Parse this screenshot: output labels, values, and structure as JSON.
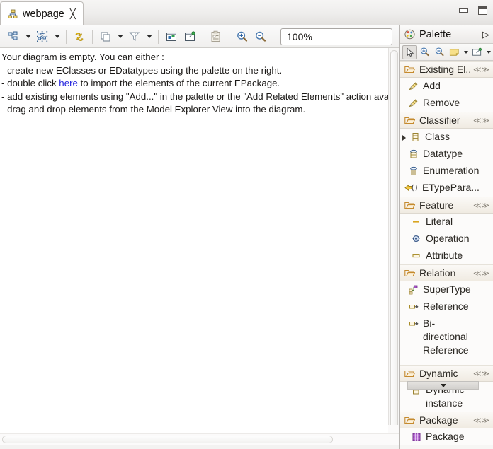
{
  "window": {
    "minimize_label": "Minimize",
    "maximize_label": "Maximize"
  },
  "tab": {
    "title": "webpage",
    "icon": "diagram-icon",
    "close_glyph": "╳"
  },
  "toolbar": {
    "items": [
      {
        "name": "arrange-all-button",
        "icon": "arrange-all-icon",
        "has_dropdown": true
      },
      {
        "name": "select-related-button",
        "icon": "select-nodes-icon",
        "has_dropdown": true
      },
      {
        "name": "refresh-button",
        "icon": "refresh-arrows-icon",
        "has_dropdown": false
      },
      {
        "name": "layers-button",
        "icon": "layers-icon",
        "has_dropdown": true
      },
      {
        "name": "filters-button",
        "icon": "filter-funnel-icon",
        "has_dropdown": true
      },
      {
        "name": "show-hide-button",
        "icon": "window-blue-icon",
        "has_dropdown": false
      },
      {
        "name": "pin-elements-button",
        "icon": "window-pin-icon",
        "has_dropdown": false
      },
      {
        "name": "paste-button",
        "icon": "clipboard-icon",
        "has_dropdown": false
      },
      {
        "name": "zoom-in-button",
        "icon": "zoom-in-icon",
        "has_dropdown": false
      },
      {
        "name": "zoom-out-button",
        "icon": "zoom-out-icon",
        "has_dropdown": false
      }
    ],
    "zoom_value": "100%",
    "zoom_placeholder": "100%"
  },
  "canvas": {
    "lines": [
      "Your diagram is empty. You can either :",
      "- create new EClasses or EDatatypes using the palette on the right.",
      "- double click ",
      "- add existing elements using \"Add...\" in the palette or the \"Add Related Elements\" action available u",
      "- drag and drop elements from the Model Explorer View into the diagram."
    ],
    "link_text": "here",
    "line3_suffix": " to import the elements of the current EPackage."
  },
  "palette": {
    "title": "Palette",
    "icon": "palette-icon",
    "collapse_glyph": "▷",
    "tools": [
      {
        "name": "select-tool",
        "icon": "arrow-cursor-icon",
        "pressed": true,
        "caret": false
      },
      {
        "name": "marquee-zoom-in-tool",
        "icon": "zoom-in-icon",
        "pressed": false,
        "caret": false
      },
      {
        "name": "marquee-zoom-out-tool",
        "icon": "zoom-out-icon",
        "pressed": false,
        "caret": false
      },
      {
        "name": "note-tool",
        "icon": "note-icon",
        "pressed": false,
        "caret": true
      },
      {
        "name": "note-attachment-tool",
        "icon": "note-pin-icon",
        "pressed": false,
        "caret": true
      }
    ],
    "drawers": [
      {
        "name": "existing-elements",
        "label": "Existing El...",
        "pin": "≪≫",
        "items": [
          {
            "name": "palette-item-add",
            "label": "Add",
            "icon": "add-pencil-icon",
            "expandable": false
          },
          {
            "name": "palette-item-remove",
            "label": "Remove",
            "icon": "remove-pencil-icon",
            "expandable": false
          }
        ]
      },
      {
        "name": "classifier",
        "label": "Classifier",
        "pin": "≪≫",
        "items": [
          {
            "name": "palette-item-class",
            "label": "Class",
            "icon": "class-icon",
            "expandable": true
          },
          {
            "name": "palette-item-datatype",
            "label": "Datatype",
            "icon": "datatype-icon",
            "expandable": false
          },
          {
            "name": "palette-item-enumeration",
            "label": "Enumeration",
            "icon": "enumeration-icon",
            "expandable": false
          },
          {
            "name": "palette-item-etypeparameter",
            "label": "ETypePara...",
            "icon": "etypeparameter-icon",
            "expandable": false
          }
        ]
      },
      {
        "name": "feature",
        "label": "Feature",
        "pin": "≪≫",
        "items": [
          {
            "name": "palette-item-literal",
            "label": "Literal",
            "icon": "literal-icon",
            "expandable": false
          },
          {
            "name": "palette-item-operation",
            "label": "Operation",
            "icon": "operation-icon",
            "expandable": false
          },
          {
            "name": "palette-item-attribute",
            "label": "Attribute",
            "icon": "attribute-icon",
            "expandable": false
          }
        ]
      },
      {
        "name": "relation",
        "label": "Relation",
        "pin": "≪≫",
        "items": [
          {
            "name": "palette-item-supertype",
            "label": "SuperType",
            "icon": "supertype-icon",
            "expandable": false
          },
          {
            "name": "palette-item-reference",
            "label": "Reference",
            "icon": "reference-icon",
            "expandable": false
          },
          {
            "name": "palette-item-bidirectional-reference",
            "label": "Bi-directional Reference",
            "icon": "reference-icon",
            "expandable": false
          }
        ]
      },
      {
        "name": "dynamic",
        "label": "Dynamic",
        "pin": "≪≫",
        "items": [
          {
            "name": "palette-item-dynamic-instance",
            "label": "Dynamic instance",
            "icon": "dynamic-instance-icon",
            "expandable": false
          }
        ]
      },
      {
        "name": "package",
        "label": "Package",
        "pin": "≪≫",
        "items": [
          {
            "name": "palette-item-package",
            "label": "Package",
            "icon": "package-icon",
            "expandable": false
          }
        ]
      }
    ]
  }
}
